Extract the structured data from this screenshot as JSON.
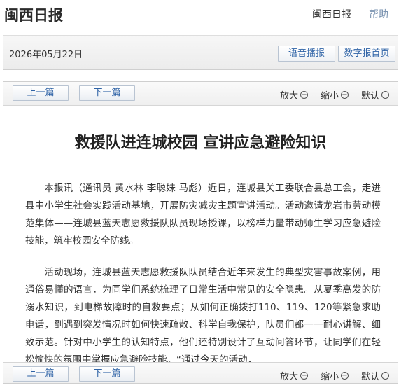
{
  "header": {
    "brand": "闽西日报",
    "link_home": "闽西日报",
    "link_help": "帮助"
  },
  "datebar": {
    "date": "2026年05月22日",
    "voice_button": "语音播报",
    "digital_button": "数字报首页"
  },
  "nav": {
    "prev_label": "上一篇",
    "next_label": "下一篇",
    "zoom_in": "放大",
    "zoom_out": "缩小",
    "zoom_default": "默认"
  },
  "article": {
    "title": "救援队进连城校园 宣讲应急避险知识",
    "paragraphs": [
      "本报讯（通讯员 黄水林 李聪妹 马彪）近日，连城县关工委联合县总工会，走进县中小学生社会实践活动基地，开展防灾减灾主题宣讲活动。活动邀请龙岩市劳动模范集体——连城县蓝天志愿救援队队员现场授课，以榜样力量带动师生学习应急避险技能，筑牢校园安全防线。",
      "活动现场，连城县蓝天志愿救援队队员结合近年来发生的典型灾害事故案例，用通俗易懂的语言，为同学们系统梳理了日常生活中常见的安全隐患。从夏季高发的防溺水知识，到电梯故障时的自救要点；从如何正确拨打110、119、120等紧急求助电话，到遇到突发情况时如何快速疏散、科学自我保护，队员们都一一耐心讲解、细致示范。针对中小学生的认知特点，他们还特别设计了互动问答环节，让同学们在轻松愉快的氛围中掌握应急避险技能。“通过今天的活动，"
    ]
  },
  "colors": {
    "button_text": "#2f63a6",
    "help_link": "#7a93b0"
  }
}
